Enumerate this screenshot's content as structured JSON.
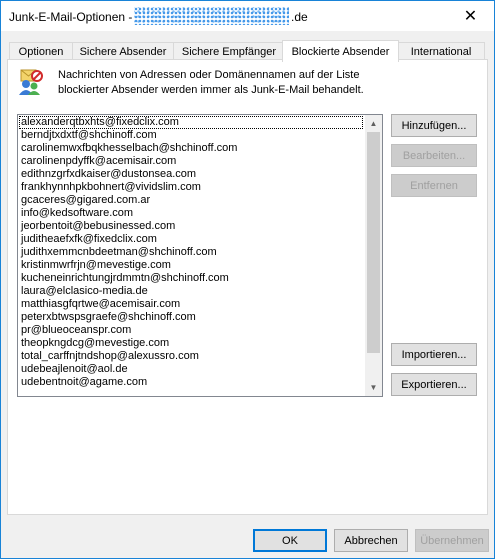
{
  "window": {
    "title_prefix": "Junk-E-Mail-Optionen - ",
    "title_suffix": ".de",
    "close_glyph": "✕"
  },
  "tabs": [
    {
      "label": "Optionen"
    },
    {
      "label": "Sichere Absender"
    },
    {
      "label": "Sichere Empfänger"
    },
    {
      "label": "Blockierte Absender"
    },
    {
      "label": "International"
    }
  ],
  "description": {
    "line1": "Nachrichten von Adressen oder Domänennamen auf der Liste",
    "line2": "blockierter Absender werden immer als Junk-E-Mail behandelt."
  },
  "blocked_senders": [
    "alexanderqtbxhts@fixedclix.com",
    "berndjtxdxtf@shchinoff.com",
    "carolinemwxfbqkhesselbach@shchinoff.com",
    "carolinenpdyffk@acemisair.com",
    "edithnzgrfxdkaiser@dustonsea.com",
    "frankhynnhpkbohnert@vividslim.com",
    "gcaceres@gigared.com.ar",
    "info@kedsoftware.com",
    "jeorbentoit@bebusinessed.com",
    "judithеaefxfk@fixedclix.com",
    "judithxemmcnbdeetman@shchinoff.com",
    "kristinmwrfrjn@mevestige.com",
    "kucheneinrichtungjrdmmtn@shchinoff.com",
    "laura@elclasico-media.de",
    "matthiasgfqrtwe@acemisair.com",
    "peterxbtwspsgraefe@shchinoff.com",
    "pr@blueoceanspr.com",
    "theopkngdcg@mevestige.com",
    "total_carffnjtndshop@alexussro.com",
    "udebeajlenoit@aol.de",
    "udebentnoit@agame.com"
  ],
  "buttons": {
    "add": "Hinzufügen...",
    "edit": "Bearbeiten...",
    "remove": "Entfernen",
    "import": "Importieren...",
    "export": "Exportieren...",
    "ok": "OK",
    "cancel": "Abbrechen",
    "apply": "Übernehmen"
  },
  "icons": {
    "info": "blocked-senders-people-icon",
    "scroll_up": "▲",
    "scroll_down": "▼"
  }
}
